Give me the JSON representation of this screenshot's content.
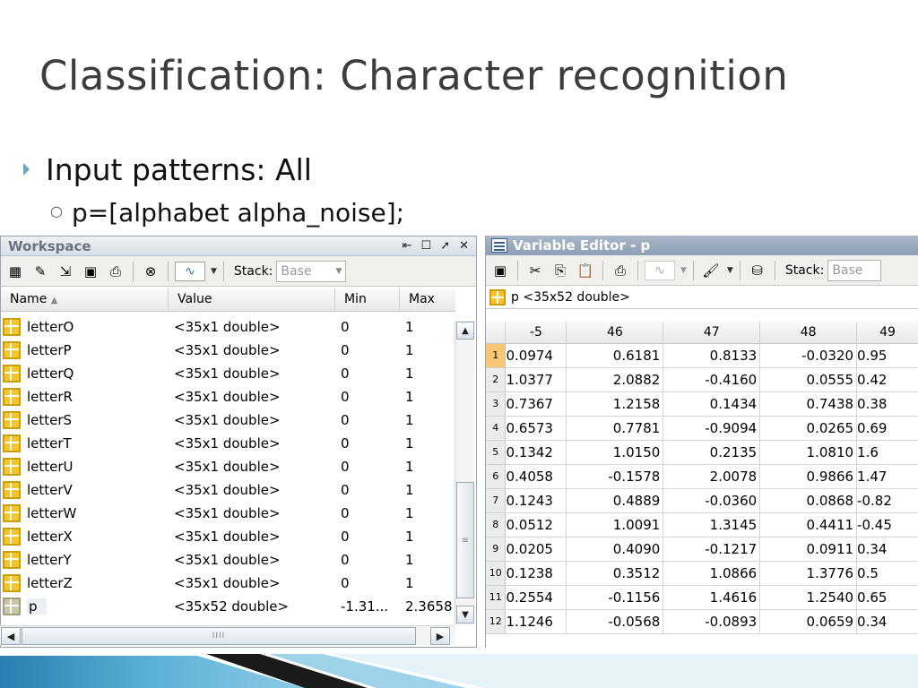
{
  "slide": {
    "title": "Classification: Character recognition",
    "bullet1": "Input patterns: All",
    "bullet2": "p=[alphabet alpha_noise];"
  },
  "workspace": {
    "title": "Workspace",
    "stack_label": "Stack:",
    "stack_value": "Base",
    "columns": {
      "name": "Name",
      "value": "Value",
      "min": "Min",
      "max": "Max"
    },
    "rows": [
      {
        "name": "letterO",
        "value": "<35x1 double>",
        "min": "0",
        "max": "1"
      },
      {
        "name": "letterP",
        "value": "<35x1 double>",
        "min": "0",
        "max": "1"
      },
      {
        "name": "letterQ",
        "value": "<35x1 double>",
        "min": "0",
        "max": "1"
      },
      {
        "name": "letterR",
        "value": "<35x1 double>",
        "min": "0",
        "max": "1"
      },
      {
        "name": "letterS",
        "value": "<35x1 double>",
        "min": "0",
        "max": "1"
      },
      {
        "name": "letterT",
        "value": "<35x1 double>",
        "min": "0",
        "max": "1"
      },
      {
        "name": "letterU",
        "value": "<35x1 double>",
        "min": "0",
        "max": "1"
      },
      {
        "name": "letterV",
        "value": "<35x1 double>",
        "min": "0",
        "max": "1"
      },
      {
        "name": "letterW",
        "value": "<35x1 double>",
        "min": "0",
        "max": "1"
      },
      {
        "name": "letterX",
        "value": "<35x1 double>",
        "min": "0",
        "max": "1"
      },
      {
        "name": "letterY",
        "value": "<35x1 double>",
        "min": "0",
        "max": "1"
      },
      {
        "name": "letterZ",
        "value": "<35x1 double>",
        "min": "0",
        "max": "1"
      },
      {
        "name": "p",
        "value": "<35x52 double>",
        "min": "-1.31...",
        "max": "2.3658"
      }
    ]
  },
  "variable_editor": {
    "title": "Variable Editor - p",
    "stack_label": "Stack:",
    "stack_value": "Base",
    "var_label": "p <35x52 double>",
    "columns": [
      "-5",
      "46",
      "47",
      "48",
      "49"
    ],
    "rows": [
      {
        "idx": "1",
        "cells": [
          "0.0974",
          "0.6181",
          "0.8133",
          "-0.0320",
          "0.95"
        ]
      },
      {
        "idx": "2",
        "cells": [
          "1.0377",
          "2.0882",
          "-0.4160",
          "0.0555",
          "0.42"
        ]
      },
      {
        "idx": "3",
        "cells": [
          "0.7367",
          "1.2158",
          "0.1434",
          "0.7438",
          "0.38"
        ]
      },
      {
        "idx": "4",
        "cells": [
          "0.6573",
          "0.7781",
          "-0.9094",
          "0.0265",
          "0.69"
        ]
      },
      {
        "idx": "5",
        "cells": [
          "0.1342",
          "1.0150",
          "0.2135",
          "1.0810",
          "1.6"
        ]
      },
      {
        "idx": "6",
        "cells": [
          "0.4058",
          "-0.1578",
          "2.0078",
          "0.9866",
          "1.47"
        ]
      },
      {
        "idx": "7",
        "cells": [
          "0.1243",
          "0.4889",
          "-0.0360",
          "0.0868",
          "-0.82"
        ]
      },
      {
        "idx": "8",
        "cells": [
          "0.0512",
          "1.0091",
          "1.3145",
          "0.4411",
          "-0.45"
        ]
      },
      {
        "idx": "9",
        "cells": [
          "0.0205",
          "0.4090",
          "-0.1217",
          "0.0911",
          "0.34"
        ]
      },
      {
        "idx": "10",
        "cells": [
          "0.1238",
          "0.3512",
          "1.0866",
          "1.3776",
          "0.5"
        ]
      },
      {
        "idx": "11",
        "cells": [
          "0.2554",
          "-0.1156",
          "1.4616",
          "1.2540",
          "0.65"
        ]
      },
      {
        "idx": "12",
        "cells": [
          "1.1246",
          "-0.0568",
          "-0.0893",
          "0.0659",
          "0.34"
        ]
      }
    ]
  },
  "colors": {
    "title_text": "#3d3d3d",
    "bullet_marker": "#6aa7c7",
    "selected_row_header": "#f9c673",
    "variable_icon": "#f7c52a",
    "band_blue": "#5bb0d6"
  }
}
